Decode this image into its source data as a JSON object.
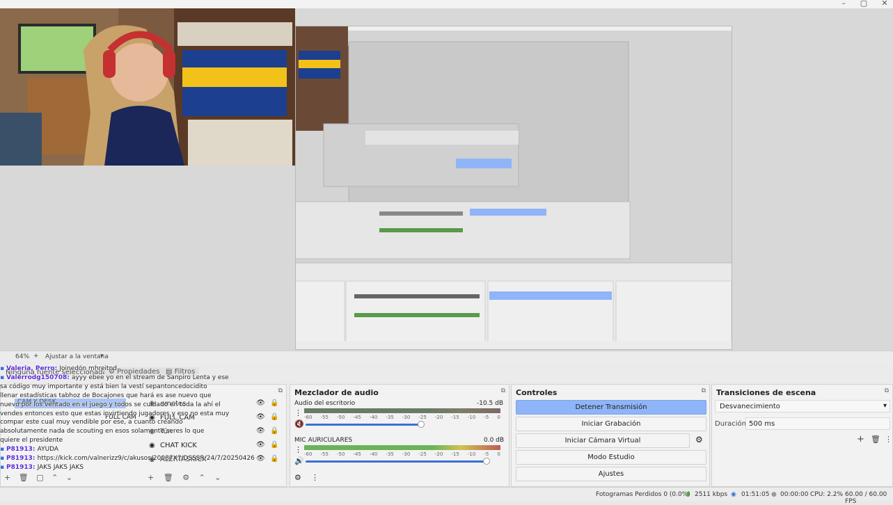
{
  "window": {
    "min": "–",
    "max": "▢",
    "close": "✕"
  },
  "preview_bar": {
    "zoom": "64%",
    "add": "+",
    "fit": "Ajustar a la ventana",
    "dropdown": "▾"
  },
  "source_tabs": {
    "no_source": "Ninguna fuente seleccionada",
    "properties": "Propiedades",
    "filters": "Filtros"
  },
  "sources": [
    {
      "label": "emotes",
      "vis": "👁",
      "lock": "🔒"
    },
    {
      "label": "FULL CAM",
      "vis": "👁",
      "lock": "🔒"
    },
    {
      "label": "Tún",
      "vis": "👁",
      "lock": "🔒"
    },
    {
      "label": "CHAT KICK",
      "vis": "👁",
      "lock": "🔒"
    },
    {
      "label": "ALERTASKICK",
      "vis": "👁",
      "lock": "🔒"
    }
  ],
  "source_toolbar": [
    "+",
    "🗑",
    "⚙",
    "⌃",
    "⌄"
  ],
  "scene_labels": [
    "CAM Y DESK",
    "FULL CAM"
  ],
  "scene_toolbar": [
    "+",
    "🗑",
    "▢",
    "⌃",
    "⌄"
  ],
  "audio": {
    "title": "Mezclador de audio",
    "channels": [
      {
        "name": "Audio del escritorio",
        "level": "-10.5 dB",
        "scale": [
          "-60",
          "-55",
          "-50",
          "-45",
          "-40",
          "-35",
          "-30",
          "-25",
          "-20",
          "-15",
          "-10",
          "-5",
          "0"
        ],
        "volume_fraction": 0.62,
        "muted": true
      },
      {
        "name": "MIC AURICULARES",
        "level": "0.0 dB",
        "scale": [
          "-60",
          "-55",
          "-50",
          "-45",
          "-40",
          "-35",
          "-30",
          "-25",
          "-20",
          "-15",
          "-10",
          "-5",
          "0"
        ],
        "volume_fraction": 0.97,
        "muted": false
      }
    ],
    "footer_icons": [
      "⚙",
      "⋮"
    ]
  },
  "controls": {
    "title": "Controles",
    "buttons": [
      "Detener Transmisión",
      "Iniciar Grabación",
      "Iniciar Cámara Virtual",
      "Modo Estudio",
      "Ajustes"
    ],
    "gear": "⚙"
  },
  "transitions": {
    "title": "Transiciones de escena",
    "type": "Desvanecimiento",
    "duration_label": "Duración",
    "duration_value": "500 ms",
    "add": "+",
    "del": "🗑",
    "more": "⋮"
  },
  "chat": [
    {
      "name": "Valeria, Perro",
      "text": "Joinedón mhreitnd"
    },
    {
      "name": "Valerrodg150708",
      "text": "ayyy ebee yo en el stream de Sanpiro Lenta y ese"
    },
    {
      "name": "",
      "text": "sa código muy importante y está bien la vestí sepantoncedocidito"
    },
    {
      "name": "",
      "text": "llenar estadísticas tabhoz de Bocajones que hará es ase nuevo que"
    },
    {
      "name": "",
      "text": "nuevo por los ventado en el juego y todos se cuidado en toda la ahí el"
    },
    {
      "name": "",
      "text": "vendes entonces esto que estas invirtiendo jugadores y eso no esta muy"
    },
    {
      "name": "",
      "text": "compar este cual muy vendible por ese, a cuanto creando"
    },
    {
      "name": "",
      "text": "absolutamente nada de scouting en esos solamente seres lo que"
    },
    {
      "name": "",
      "text": "quiere el presidente"
    },
    {
      "name": "P81913",
      "text": "AYUDA"
    },
    {
      "name": "P81913",
      "text": "https://kick.com/valnerizz9/c/akusos/20087X7/DSSSR/24/7/20250426"
    },
    {
      "name": "P81913",
      "text": "JAKS JAKS JAKS"
    }
  ],
  "status": {
    "dropped": "Fotogramas Perdidos 0 (0.0%)",
    "kbps": "2511 kbps",
    "stream_time": "01:51:05",
    "rec_time": "00:00:00",
    "cpu": "CPU: 2.2%",
    "fps": "60.00 / 60.00 FPS"
  },
  "colors": {
    "accent": "#8fb4f7",
    "chat_name": "#5a2bd6",
    "mute": "#d64541",
    "meter_green": "#52a83e"
  }
}
